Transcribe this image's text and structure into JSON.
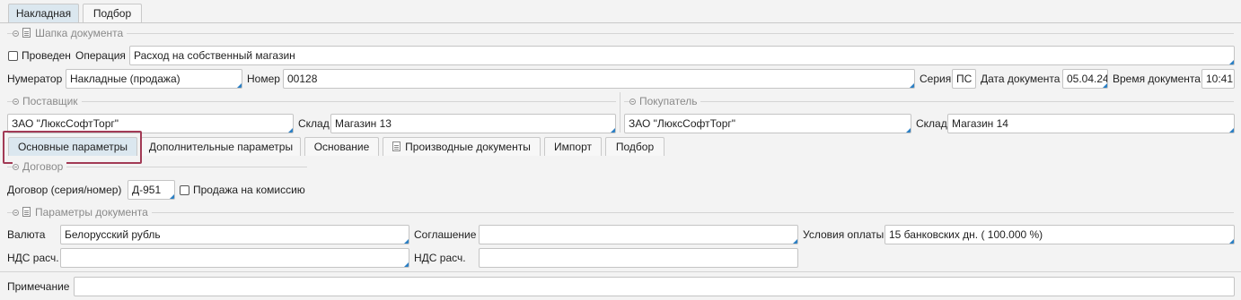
{
  "top_tabs": [
    "Накладная",
    "Подбор"
  ],
  "header_section": {
    "title": "Шапка документа",
    "posted_label": "Проведен",
    "operation_label": "Операция",
    "operation_value": "Расход на собственный магазин",
    "numerator_label": "Нумератор",
    "numerator_value": "Накладные (продажа)",
    "number_label": "Номер",
    "number_value": "00128",
    "series_label": "Серия",
    "series_value": "ПС",
    "doc_date_label": "Дата документа",
    "doc_date_value": "05.04.24",
    "doc_time_label": "Время документа",
    "doc_time_value": "10:41"
  },
  "supplier": {
    "title": "Поставщик",
    "value": "ЗАО \"ЛюксСофтТорг\"",
    "warehouse_label": "Склад",
    "warehouse_value": "Магазин 13"
  },
  "buyer": {
    "title": "Покупатель",
    "value": "ЗАО \"ЛюксСофтТорг\"",
    "warehouse_label": "Склад",
    "warehouse_value": "Магазин 14"
  },
  "inner_tabs": [
    "Основные параметры",
    "Дополнительные параметры",
    "Основание",
    "Производные документы",
    "Импорт",
    "Подбор"
  ],
  "contract": {
    "title": "Договор",
    "label": "Договор (серия/номер)",
    "value": "Д-951",
    "commission_label": "Продажа на комиссию"
  },
  "doc_params": {
    "title": "Параметры документа",
    "currency_label": "Валюта",
    "currency_value": "Белорусский рубль",
    "agreement_label": "Соглашение",
    "agreement_value": "",
    "payment_label": "Условия оплаты",
    "payment_value": "15 банковских дн. ( 100.000 %)",
    "vat1_label": "НДС расч.",
    "vat1_value": "",
    "vat2_label": "НДС расч.",
    "vat2_value": ""
  },
  "note": {
    "label": "Примечание",
    "value": ""
  }
}
